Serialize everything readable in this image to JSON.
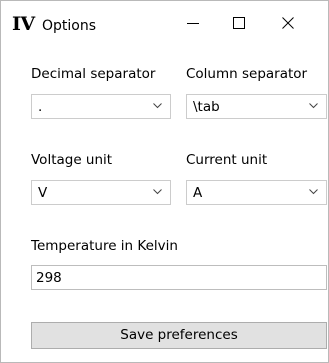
{
  "window": {
    "logo_text": "IV",
    "title": "Options",
    "controls": [
      "minimize",
      "maximize",
      "close"
    ]
  },
  "form": {
    "decimal_separator": {
      "label": "Decimal separator",
      "value": "."
    },
    "column_separator": {
      "label": "Column separator",
      "value": "\\tab"
    },
    "voltage_unit": {
      "label": "Voltage unit",
      "value": "V"
    },
    "current_unit": {
      "label": "Current unit",
      "value": "A"
    },
    "temperature": {
      "label": "Temperature in Kelvin",
      "value": "298"
    },
    "save_button": "Save preferences"
  },
  "icons": {
    "minimize": "minimize-icon",
    "maximize": "maximize-icon",
    "close": "close-icon",
    "dropdown": "chevron-down-icon"
  },
  "colors": {
    "button_background": "#e1e1e1",
    "button_border": "#adadad",
    "field_border": "#cccccc",
    "window_border": "#b9b9b9"
  }
}
